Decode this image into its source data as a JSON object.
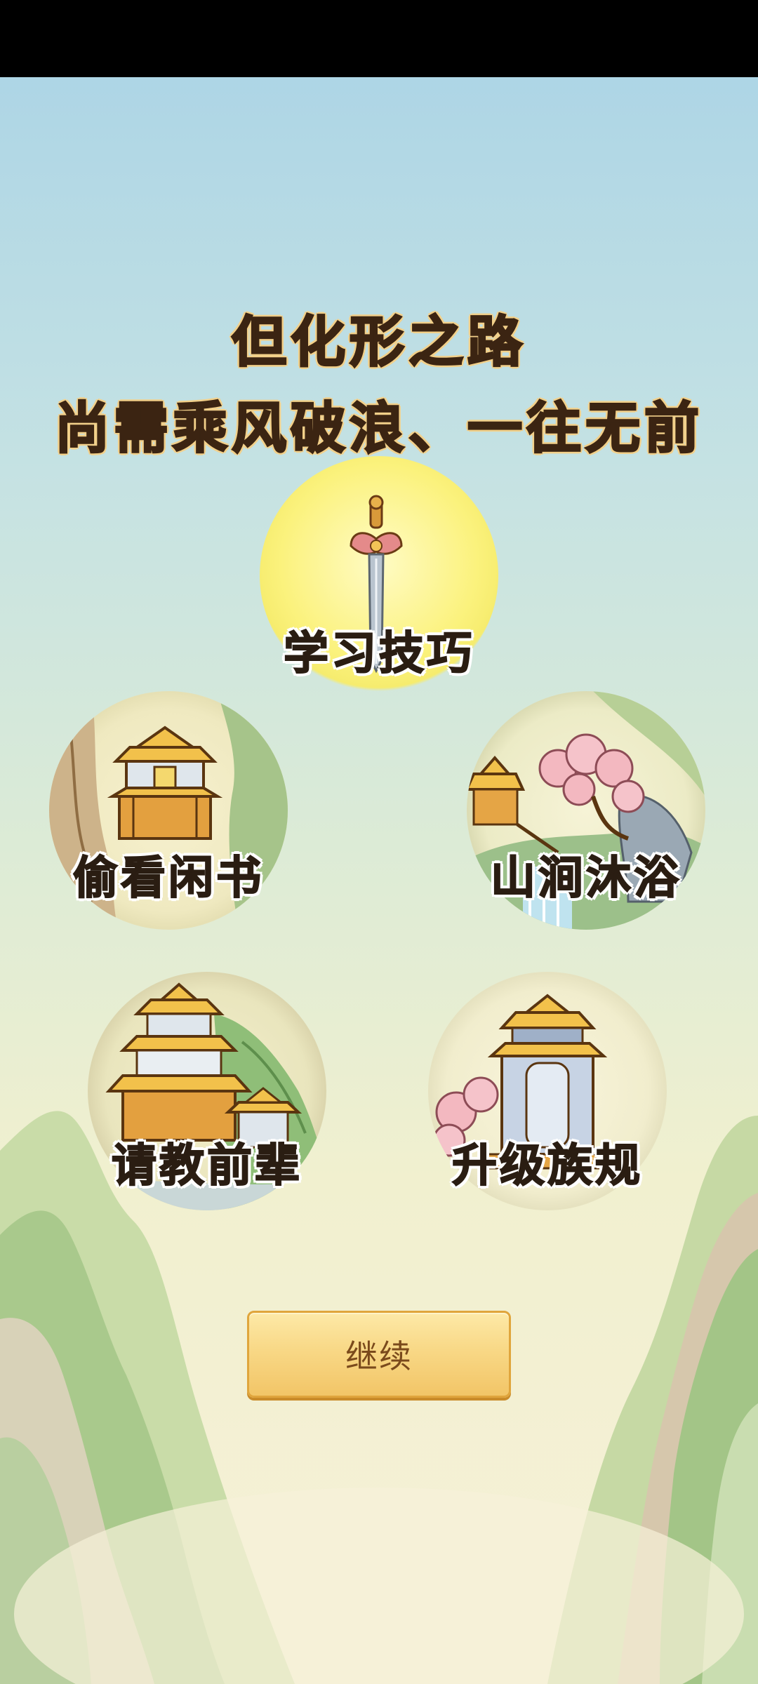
{
  "title": {
    "line1": "但化形之路",
    "line2": "尚需乘风破浪、一往无前"
  },
  "options": {
    "skill": {
      "label": "学习技巧",
      "icon": "sword-icon"
    },
    "read": {
      "label": "偷看闲书",
      "icon": "pavilion-icon"
    },
    "bath": {
      "label": "山涧沐浴",
      "icon": "waterfall-icon"
    },
    "elder": {
      "label": "请教前辈",
      "icon": "palace-icon"
    },
    "rules": {
      "label": "升级族规",
      "icon": "shrine-icon"
    }
  },
  "continue_button": {
    "label": "继续"
  },
  "colors": {
    "title_text": "#3b2412",
    "title_outline": "#f2d08a",
    "button_gold": "#f8d886",
    "button_text": "#7a4a1c"
  }
}
